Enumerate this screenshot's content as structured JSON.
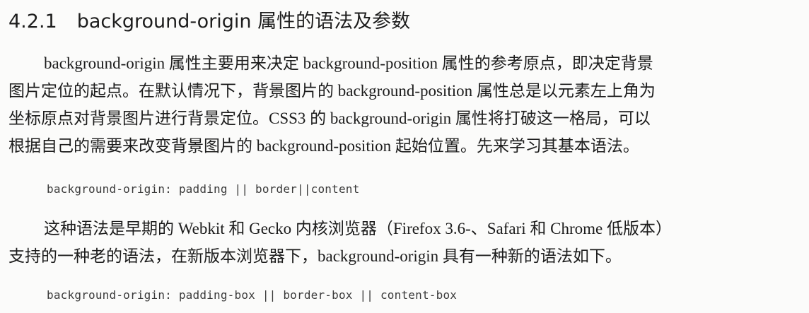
{
  "section": {
    "number": "4.2.1",
    "title": "background-origin 属性的语法及参数"
  },
  "paragraph1": {
    "lines": [
      "background-origin 属性主要用来决定 background-position 属性的参考原点，即决定背景",
      "图片定位的起点。在默认情况下，背景图片的 background-position 属性总是以元素左上角为",
      "坐标原点对背景图片进行背景定位。CSS3 的 background-origin 属性将打破这一格局，可以",
      "根据自己的需要来改变背景图片的 background-position 起始位置。先来学习其基本语法。"
    ]
  },
  "code1": "background-origin: padding || border||content",
  "paragraph2": {
    "lines": [
      "这种语法是早期的 Webkit 和 Gecko 内核浏览器（Firefox 3.6-、Safari 和 Chrome 低版本）",
      "支持的一种老的语法，在新版本浏览器下，background-origin 具有一种新的语法如下。"
    ]
  },
  "code2": "background-origin: padding-box || border-box || content-box"
}
